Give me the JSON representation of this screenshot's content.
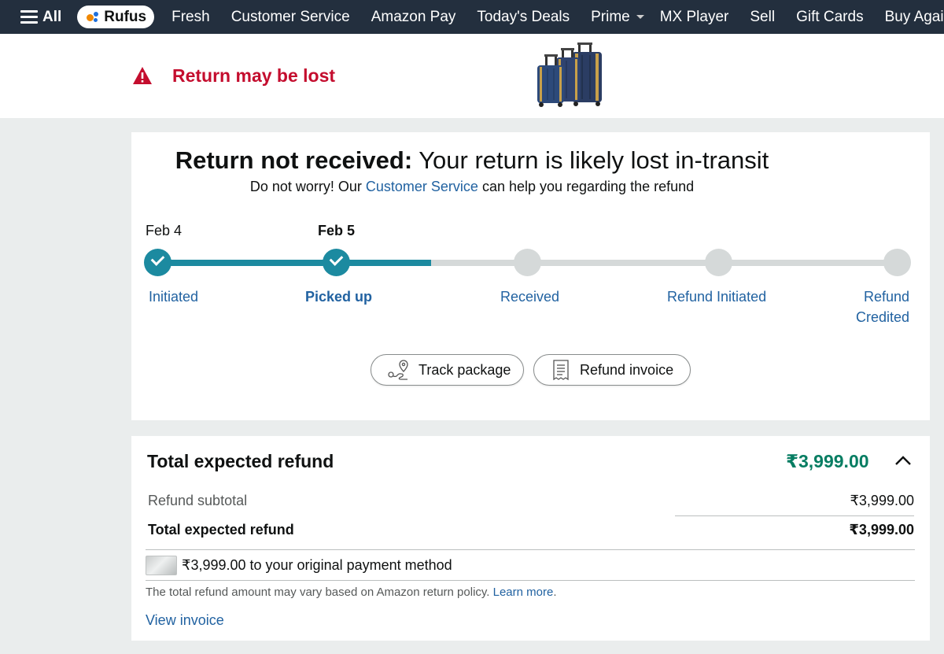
{
  "nav": {
    "all": "All",
    "rufus": "Rufus",
    "links": [
      "Fresh",
      "Customer Service",
      "Amazon Pay",
      "Today's Deals"
    ],
    "prime": "Prime",
    "links2": [
      "MX Player",
      "Sell",
      "Gift Cards",
      "Buy Again"
    ]
  },
  "banner": {
    "title": "Return may be lost",
    "product_image": "luggage-set-navy-blue"
  },
  "status": {
    "headline_bold": "Return not received:",
    "headline_rest": " Your return is likely lost in-transit",
    "sub_before": "Do not worry! Our ",
    "sub_link": "Customer Service",
    "sub_after": " can help you regarding the refund",
    "progress_percent": 37,
    "steps": [
      {
        "date": "Feb 4",
        "label": "Initiated",
        "done": true,
        "current": false
      },
      {
        "date": "Feb 5",
        "label": "Picked up",
        "done": true,
        "current": true
      },
      {
        "date": "",
        "label": "Received",
        "done": false,
        "current": false
      },
      {
        "date": "",
        "label": "Refund Initiated",
        "done": false,
        "current": false
      },
      {
        "date": "",
        "label": "Refund Credited",
        "label_line1": "Refund",
        "label_line2": "Credited",
        "done": false,
        "current": false
      }
    ],
    "buttons": {
      "track": "Track package",
      "invoice": "Refund invoice"
    }
  },
  "refund": {
    "title": "Total expected refund",
    "amount": "₹3,999.00",
    "subtotal_label": "Refund subtotal",
    "subtotal_value": "₹3,999.00",
    "total_label": "Total expected refund",
    "total_value": "₹3,999.00",
    "payment_text": "₹3,999.00 to your original payment method",
    "policy_text": "The total refund amount may vary based on Amazon return policy. ",
    "learn_more": "Learn more",
    "policy_end": ".",
    "view_invoice": "View invoice"
  },
  "colors": {
    "nav_bg": "#232f3e",
    "alert_red": "#c40d2e",
    "progress_teal": "#1c8aa0",
    "link_blue": "#2162a1",
    "refund_green": "#067d62"
  }
}
